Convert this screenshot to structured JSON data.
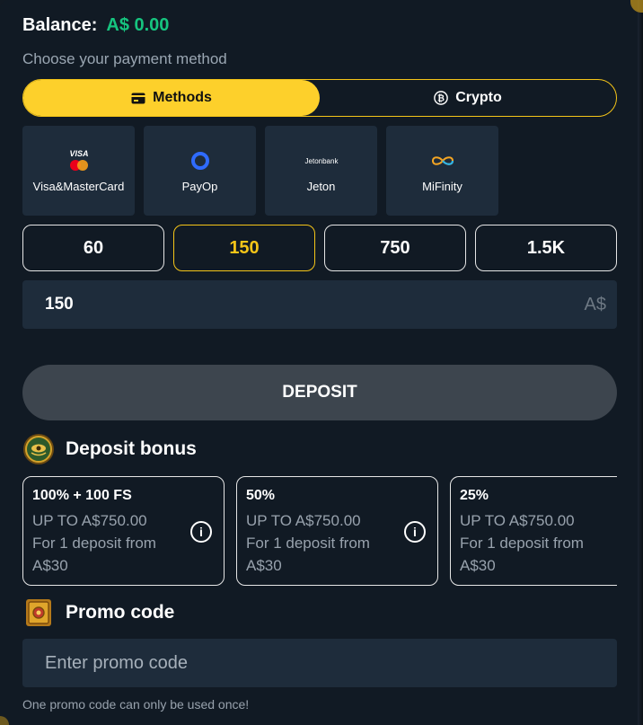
{
  "balance": {
    "label": "Balance:",
    "amount": "A$ 0.00"
  },
  "choose_label": "Choose your payment method",
  "tabs": [
    {
      "label": "Methods",
      "icon": "card-icon",
      "active": true
    },
    {
      "label": "Crypto",
      "icon": "bitcoin-icon",
      "active": false
    }
  ],
  "methods": [
    {
      "name": "Visa&MasterCard",
      "logo_text": "VISA"
    },
    {
      "name": "PayOp"
    },
    {
      "name": "Jeton",
      "logo_text": "Jetonbank"
    },
    {
      "name": "MiFinity"
    }
  ],
  "amount_options": [
    "60",
    "150",
    "750",
    "1.5K"
  ],
  "selected_amount": "150",
  "amount_input": {
    "value": "150",
    "currency": "A$"
  },
  "deposit_label": "DEPOSIT",
  "bonus_section": {
    "title": "Deposit bonus",
    "cards": [
      {
        "title": "100% + 100 FS",
        "line1": "UP TO A$750.00",
        "line2": "For 1 deposit from",
        "line3": "A$30"
      },
      {
        "title": "50%",
        "line1": "UP TO A$750.00",
        "line2": "For 1 deposit from",
        "line3": "A$30"
      },
      {
        "title": "25%",
        "line1": "UP TO A$750.00",
        "line2": "For 1 deposit from",
        "line3": "A$30"
      }
    ]
  },
  "promo": {
    "title": "Promo code",
    "placeholder": "Enter promo code",
    "note": "One promo code can only be used once!"
  },
  "colors": {
    "accent": "#fdd02b",
    "balance": "#16c47f",
    "panel": "#111a24",
    "card": "#1e2c3b",
    "deposit": "#3d454e"
  }
}
